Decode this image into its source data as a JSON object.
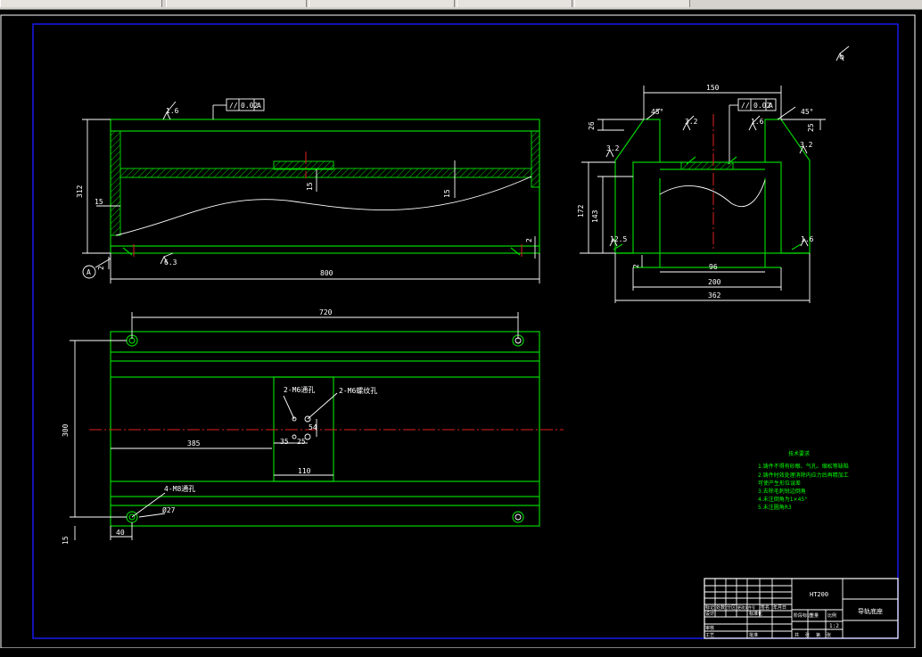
{
  "toolbar": {
    "tabs": [
      "",
      "",
      "",
      "",
      ""
    ]
  },
  "dimensions": {
    "front_length": "800",
    "front_height": "312",
    "front_left_wall": "15",
    "front_slot_depth": "15",
    "front_rib": "15",
    "front_bottom_gap_left": "2",
    "front_bottom_gap_right": "2",
    "side_top_width": "150",
    "side_height": "172",
    "side_inner_height": "143",
    "side_top_step": "26",
    "side_top_step_right": "25",
    "side_inner_width": "96",
    "side_mid_width": "200",
    "side_total_width": "362",
    "side_bottom_gap": "2",
    "chamfer_left": "45°",
    "chamfer_right": "45°",
    "top_length": "720",
    "top_height": "300",
    "top_offset": "385",
    "top_small_a": "35",
    "top_small_b": "25",
    "top_small_c": "54",
    "top_box_width": "110",
    "top_edge_x": "40",
    "top_edge_y": "15",
    "hole_note_1": "2-M6通孔",
    "hole_note_2": "2-M6螺纹孔",
    "hole_note_3": "4-M8通孔",
    "hole_dia": "Ø27"
  },
  "tolerances": {
    "flatness_front": "//",
    "flatness_front_value": "0.02",
    "flatness_front_datum": "A",
    "flatness_side": "//",
    "flatness_side_value": "0.02",
    "flatness_side_datum": "A",
    "datum_label": "A"
  },
  "roughness": [
    "1.6",
    "3.2",
    "1.6",
    "1.6",
    "3.2",
    "3.2",
    "6.3",
    "12.5",
    "1.6"
  ],
  "notes": {
    "title": "技术要求",
    "items": [
      "1.铸件不得有砂眼、气孔、缩松等缺陷",
      "2.铸件时效处理消除内应力后再精加工",
      "可使产生形位误差",
      "3.去除毛刺锐边倒角",
      "4.未注倒角为1×45°",
      "5.未注圆角R3"
    ]
  },
  "title_block": {
    "part_name": "HT200",
    "drawing_name": "导轨底座",
    "scale": "1:2",
    "cells": [
      "标记",
      "处数",
      "分区",
      "更改文件号",
      "签名",
      "年月日",
      "设计",
      "标准化",
      "阶段标记",
      "重量",
      "比例",
      "审核",
      "工艺",
      "批准",
      "共",
      "张",
      "第",
      "张"
    ]
  },
  "colors": {
    "background": "#000000",
    "outline": "#00d000",
    "dim": "#ffffff",
    "center": "#e02020",
    "border": "#1a1aff"
  }
}
